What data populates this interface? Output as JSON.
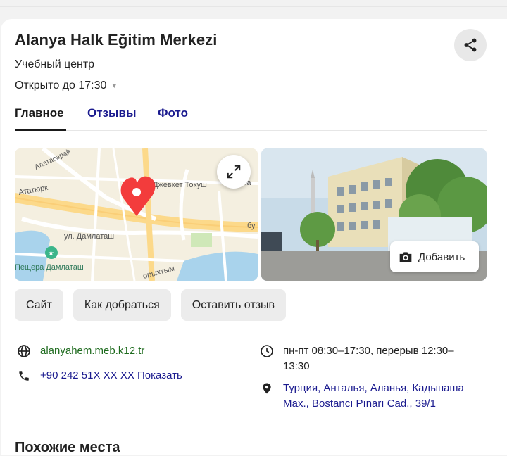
{
  "place": {
    "title": "Alanya Halk Eğitim Merkezi",
    "category": "Учебный центр",
    "hours_status": "Открыто до 17:30"
  },
  "tabs": [
    {
      "label": "Главное",
      "active": true
    },
    {
      "label": "Отзывы",
      "active": false
    },
    {
      "label": "Фото",
      "active": false
    }
  ],
  "map": {
    "labels": {
      "street_1": "Алатасарай",
      "street_2": "Ататюрк",
      "street_3": "Джевкет Токуш",
      "street_4": "ул. Дамлаташ",
      "street_5": "Ха",
      "street_6": "бу",
      "street_7": "орыхтым",
      "poi": "Пещера Дамлаташ"
    },
    "marker_color": "#f33c3c"
  },
  "photo": {
    "add_label": "Добавить"
  },
  "actions": {
    "site": "Сайт",
    "directions": "Как добраться",
    "review": "Оставить отзыв"
  },
  "contacts": {
    "website": "alanyahem.meb.k12.tr",
    "phone": "+90 242 51X XX XX Показать",
    "hours_line1": "пн-пт 08:30–17:30, перерыв 12:30–",
    "hours_line2": "13:30",
    "address_line1": "Турция, Анталья, Аланья, Кадыпаша",
    "address_line2": "Мах., Bostancı Pınarı Cad., 39/1"
  },
  "sections": {
    "nearby": "Похожие места"
  },
  "colors": {
    "link_green": "#1e6b1e",
    "link_blue": "#1b1b8f",
    "button_bg": "#ececec"
  }
}
